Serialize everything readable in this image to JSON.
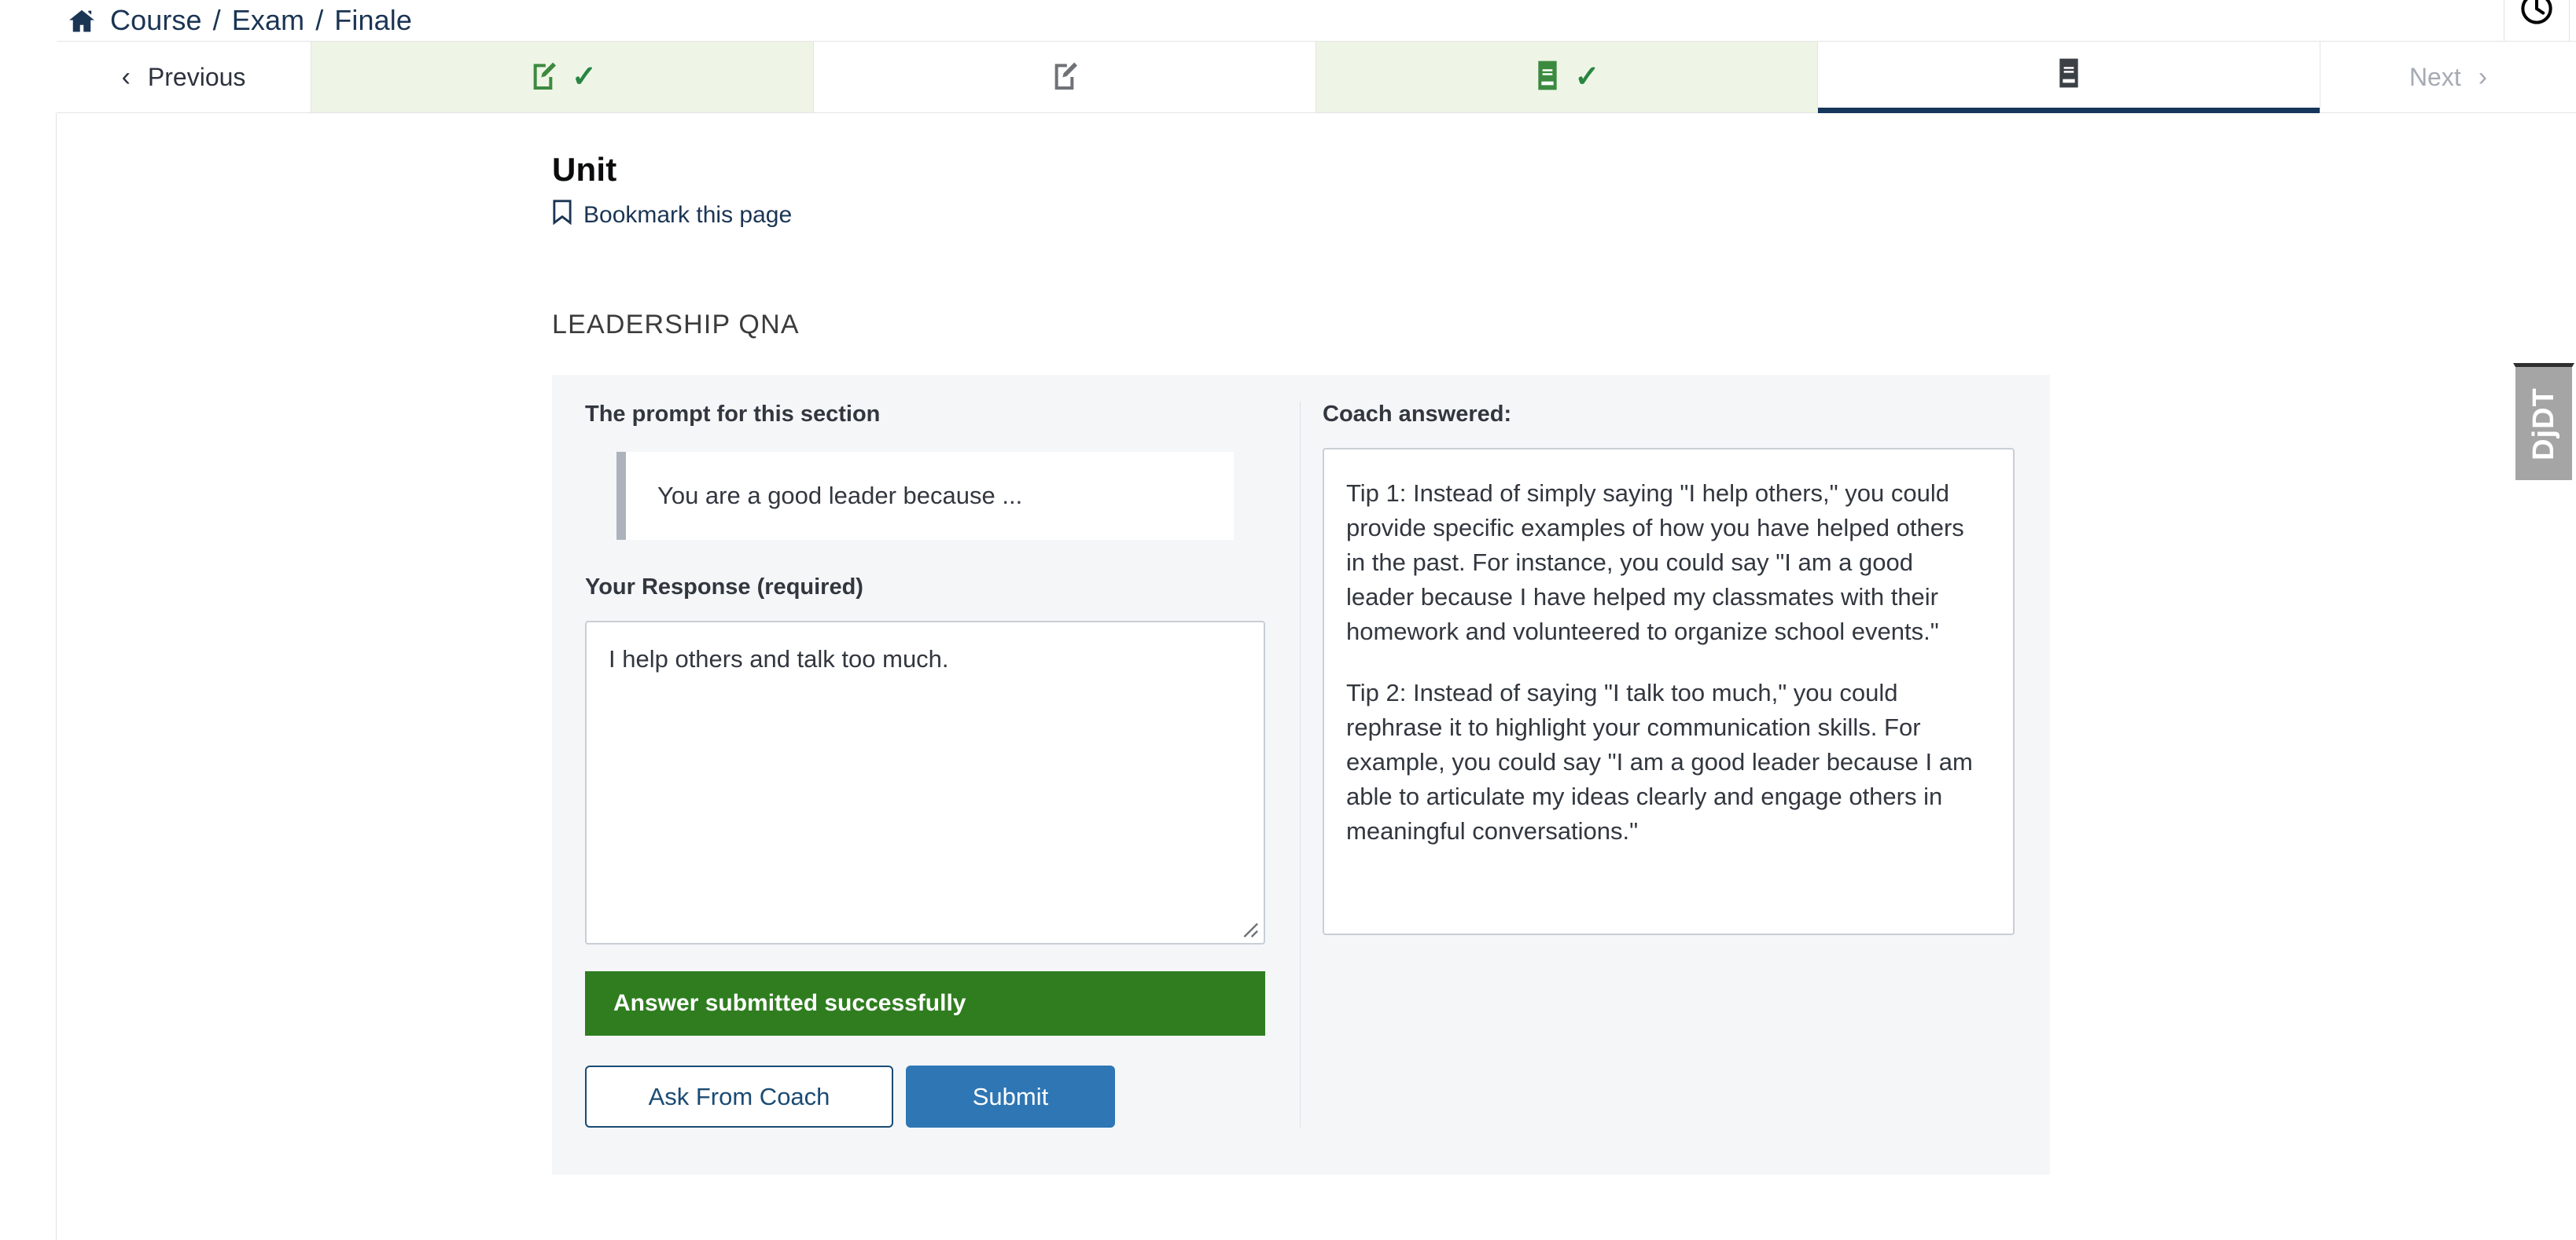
{
  "breadcrumb": {
    "home_icon": "home-icon",
    "items": [
      "Course",
      "Exam",
      "Finale"
    ],
    "separator": "/"
  },
  "header": {
    "clock_icon": "clock-icon"
  },
  "sequence": {
    "previous_label": "Previous",
    "next_label": "Next",
    "prev_chevron": "‹",
    "next_chevron": "›",
    "check_glyph": "✓",
    "tabs": [
      {
        "name": "tab-problem-1",
        "icon": "edit-square-icon",
        "state": "complete",
        "completed": true
      },
      {
        "name": "tab-problem-2",
        "icon": "edit-square-icon",
        "state": "incomplete",
        "completed": false
      },
      {
        "name": "tab-reading-1",
        "icon": "book-icon",
        "state": "complete",
        "completed": true
      },
      {
        "name": "tab-reading-2",
        "icon": "book-icon",
        "state": "active",
        "completed": false
      }
    ]
  },
  "unit": {
    "title": "Unit",
    "bookmark_label": "Bookmark this page",
    "bookmark_icon": "bookmark-icon"
  },
  "section": {
    "title": "LEADERSHIP QNA"
  },
  "qna": {
    "prompt_label": "The prompt for this section",
    "prompt_text": "You are a good leader because ...",
    "response_label": "Your Response (required)",
    "response_value": "I help others and talk too much.",
    "response_placeholder": "",
    "success_message": "Answer submitted successfully",
    "ask_coach_label": "Ask From Coach",
    "submit_label": "Submit",
    "coach_label": "Coach answered:",
    "coach_tip_1": "Tip 1: Instead of simply saying \"I help others,\" you could provide specific examples of how you have helped others in the past. For instance, you could say \"I am a good leader because I have helped my classmates with their homework and volunteered to organize school events.\"",
    "coach_tip_2": "Tip 2: Instead of saying \"I talk too much,\" you could rephrase it to highlight your communication skills. For example, you could say \"I am a good leader because I am able to articulate my ideas clearly and engage others in meaningful conversations.\""
  },
  "debug_toolbar": {
    "label": "DjDT"
  },
  "colors": {
    "brand_navy": "#16365c",
    "link_navy": "#1b3554",
    "tab_complete_bg": "#eef5e6",
    "check_green": "#288542",
    "success_green": "#2f7d1f",
    "primary_blue": "#2f76b4",
    "outline_blue": "#1b4b73",
    "panel_bg": "#f4f6f8"
  }
}
